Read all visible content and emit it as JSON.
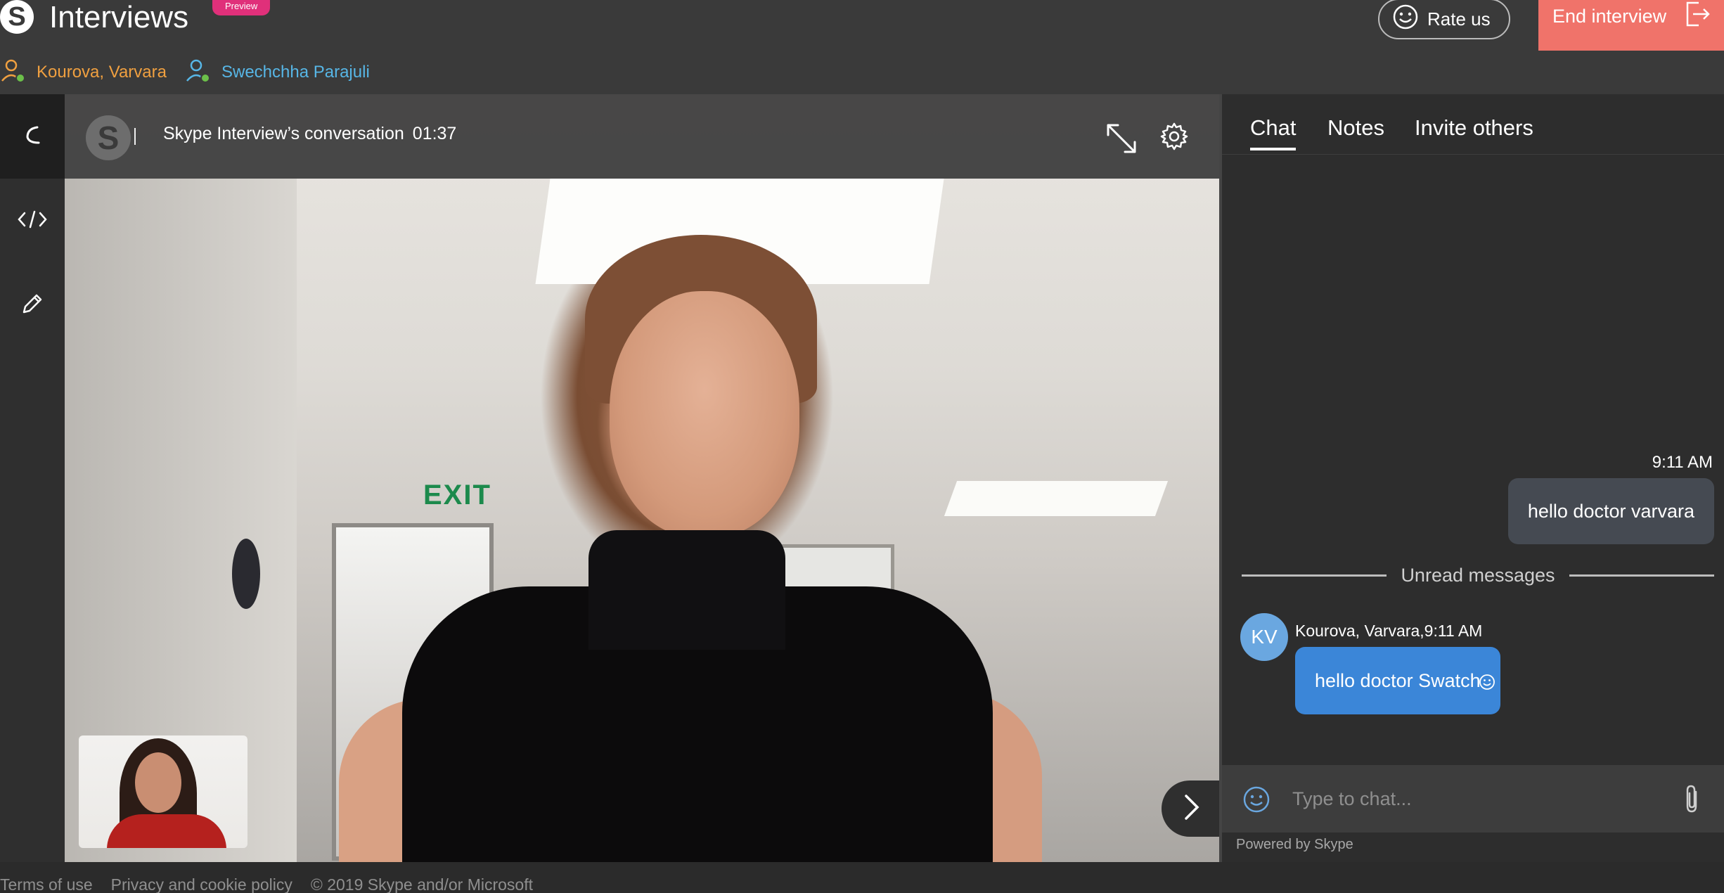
{
  "header": {
    "app_title": "Interviews",
    "badge": "Preview",
    "rate_label": "Rate us",
    "end_label": "End interview"
  },
  "participants": [
    {
      "name": "Kourova, Varvara",
      "color": "#f0a040"
    },
    {
      "name": "Swechchha Parajuli",
      "color": "#57b6e6"
    }
  ],
  "rail": {
    "items": [
      {
        "icon": "phone-icon",
        "active": true
      },
      {
        "icon": "code-icon",
        "active": false
      },
      {
        "icon": "pencil-icon",
        "active": false
      }
    ]
  },
  "video": {
    "title": "Skype Interview’s conversation",
    "duration": "01:37"
  },
  "chat": {
    "tabs": [
      "Chat",
      "Notes",
      "Invite others"
    ],
    "active_tab": "Chat",
    "outgoing": {
      "time": "9:11 AM",
      "text": "hello doctor varvara"
    },
    "unread_label": "Unread messages",
    "incoming": {
      "initials": "KV",
      "meta": "Kourova, Varvara,9:11 AM",
      "text": "hello doctor Swatch"
    },
    "placeholder": "Type to chat...",
    "powered_by": "Powered by Skype"
  },
  "footer": {
    "terms": "Terms of use",
    "privacy": "Privacy and cookie policy",
    "copyright": "© 2019 Skype and/or Microsoft"
  },
  "colors": {
    "accent_end": "#f0736a",
    "badge": "#e0307a",
    "bubble_in": "#3b86d8",
    "bubble_out": "#454a52"
  }
}
